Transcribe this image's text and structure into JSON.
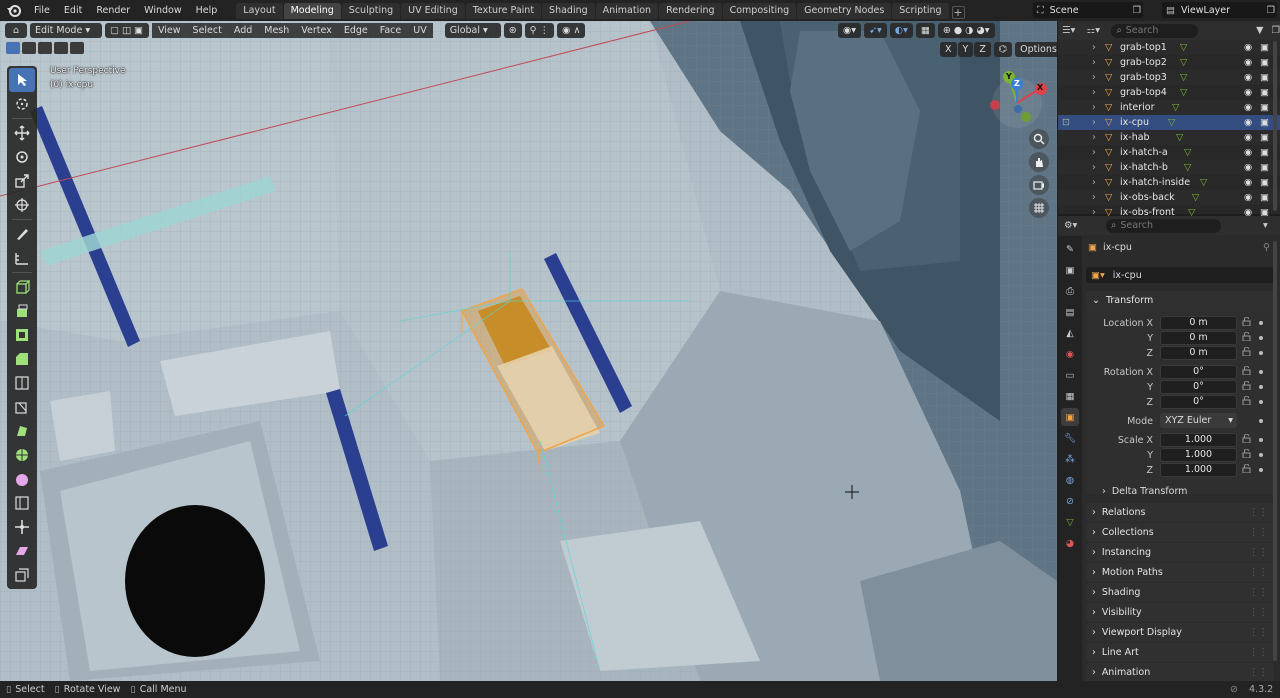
{
  "topbar": {
    "menus": [
      "File",
      "Edit",
      "Render",
      "Window",
      "Help"
    ],
    "workspaces": [
      "Layout",
      "Modeling",
      "Sculpting",
      "UV Editing",
      "Texture Paint",
      "Shading",
      "Animation",
      "Rendering",
      "Compositing",
      "Geometry Nodes",
      "Scripting"
    ],
    "active_workspace": "Modeling",
    "scene": "Scene",
    "view_layer": "ViewLayer"
  },
  "viewport": {
    "mode": "Edit Mode",
    "menus": [
      "View",
      "Select",
      "Add",
      "Mesh",
      "Vertex",
      "Edge",
      "Face",
      "UV"
    ],
    "orientation": "Global",
    "perspective_label": "User Perspective",
    "object_label": "(0) ix-cpu",
    "axis_buttons": [
      "X",
      "Y",
      "Z"
    ],
    "options_label": "Options",
    "gizmo_axes": [
      "X",
      "Y",
      "Z"
    ]
  },
  "outliner": {
    "search_placeholder": "Search",
    "rows": [
      {
        "name": "grab-top1",
        "selected": false
      },
      {
        "name": "grab-top2",
        "selected": false
      },
      {
        "name": "grab-top3",
        "selected": false
      },
      {
        "name": "grab-top4",
        "selected": false
      },
      {
        "name": "interior",
        "selected": false
      },
      {
        "name": "ix-cpu",
        "selected": true
      },
      {
        "name": "ix-hab",
        "selected": false
      },
      {
        "name": "ix-hatch-a",
        "selected": false
      },
      {
        "name": "ix-hatch-b",
        "selected": false
      },
      {
        "name": "ix-hatch-inside",
        "selected": false
      },
      {
        "name": "ix-obs-back",
        "selected": false
      },
      {
        "name": "ix-obs-front",
        "selected": false
      }
    ]
  },
  "properties": {
    "search_placeholder": "Search",
    "object_name": "ix-cpu",
    "object_field": "ix-cpu",
    "transform_title": "Transform",
    "location": {
      "label": "Location X",
      "y_label": "Y",
      "z_label": "Z",
      "x": "0 m",
      "y": "0 m",
      "z": "0 m"
    },
    "rotation": {
      "label": "Rotation X",
      "y_label": "Y",
      "z_label": "Z",
      "x": "0°",
      "y": "0°",
      "z": "0°"
    },
    "mode": {
      "label": "Mode",
      "value": "XYZ Euler"
    },
    "scale": {
      "label": "Scale X",
      "y_label": "Y",
      "z_label": "Z",
      "x": "1.000",
      "y": "1.000",
      "z": "1.000"
    },
    "delta_transform": "Delta Transform",
    "sections": [
      "Relations",
      "Collections",
      "Instancing",
      "Motion Paths",
      "Shading",
      "Visibility",
      "Viewport Display",
      "Line Art",
      "Animation"
    ]
  },
  "statusbar": {
    "select": "Select",
    "rotate_view": "Rotate View",
    "call_menu": "Call Menu",
    "version": "4.3.2"
  },
  "colors": {
    "accent": "#4772b3",
    "selected_row": "#334d80",
    "mesh_orange": "#e8a33a",
    "axis_x": "#e0414b",
    "axis_y": "#79b432",
    "axis_z": "#3c7fd6"
  }
}
